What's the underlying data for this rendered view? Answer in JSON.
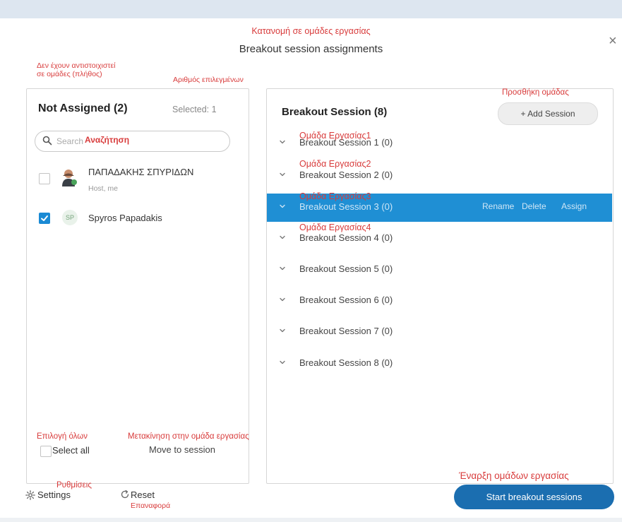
{
  "dialog": {
    "title_gr": "Κατανομή σε ομάδες εργασίας",
    "title": "Breakout session assignments",
    "close_glyph": "×"
  },
  "left": {
    "ann_not_assigned": "Δεν έχουν αντιστοιχιστεί σε ομάδες (πλήθος)",
    "ann_selected": "Αριθμός επιλεγμένων",
    "header": "Not Assigned (2)",
    "selected": "Selected: 1",
    "search_placeholder": "Search",
    "ann_search": "Αναζήτηση",
    "users": [
      {
        "name": "ΠΑΠΑΔΑΚΗΣ ΣΠΥΡΙΔΩΝ",
        "sub": "Host, me",
        "checked": false,
        "avatar": "photo"
      },
      {
        "name": "Spyros Papadakis",
        "sub": "",
        "checked": true,
        "avatar": "initials",
        "initials": "SP"
      }
    ],
    "ann_select_all": "Επιλογή όλων",
    "select_all": "Select all",
    "ann_move": "Μετακίνηση στην ομάδα εργασίας",
    "move_to_session": "Move to session"
  },
  "right": {
    "ann_add": "Προσθήκη ομάδας",
    "header": "Breakout Session  (8)",
    "add_session": "+  Add Session",
    "sessions": [
      {
        "label": "Breakout Session 1 (0)",
        "ann": "Ομάδα Εργασίας1"
      },
      {
        "label": "Breakout Session 2 (0)",
        "ann": "Ομάδα Εργασίας2"
      },
      {
        "label": "Breakout Session 3 (0)",
        "ann": "Ομάδα Εργασίας3"
      },
      {
        "label": "Breakout Session 4 (0)",
        "ann": "Ομάδα Εργασίας4"
      },
      {
        "label": "Breakout Session 5 (0)"
      },
      {
        "label": "Breakout Session 6 (0)"
      },
      {
        "label": "Breakout Session 7 (0)"
      },
      {
        "label": "Breakout Session 8 (0)"
      }
    ],
    "active_index": 2,
    "actions": {
      "rename": "Rename",
      "delete": "Delete",
      "assign": "Assign"
    }
  },
  "footer": {
    "ann_settings": "Ρυθμίσεις",
    "settings": "Settings",
    "reset": "Reset",
    "ann_reset": "Επαναφορά",
    "ann_start": "Έναρξη ομάδων εργασίας",
    "start": "Start breakout sessions"
  },
  "colors": {
    "accent": "#1f8fd4",
    "start_button": "#1b6eb0",
    "annotation": "#d83b3b",
    "checkbox_checked": "#1a8ad4"
  },
  "icons": [
    "search-icon",
    "close-icon",
    "chevron-down-icon",
    "settings-icon",
    "reset-icon",
    "plus-icon",
    "checkmark-icon",
    "user-photo-avatar"
  ]
}
